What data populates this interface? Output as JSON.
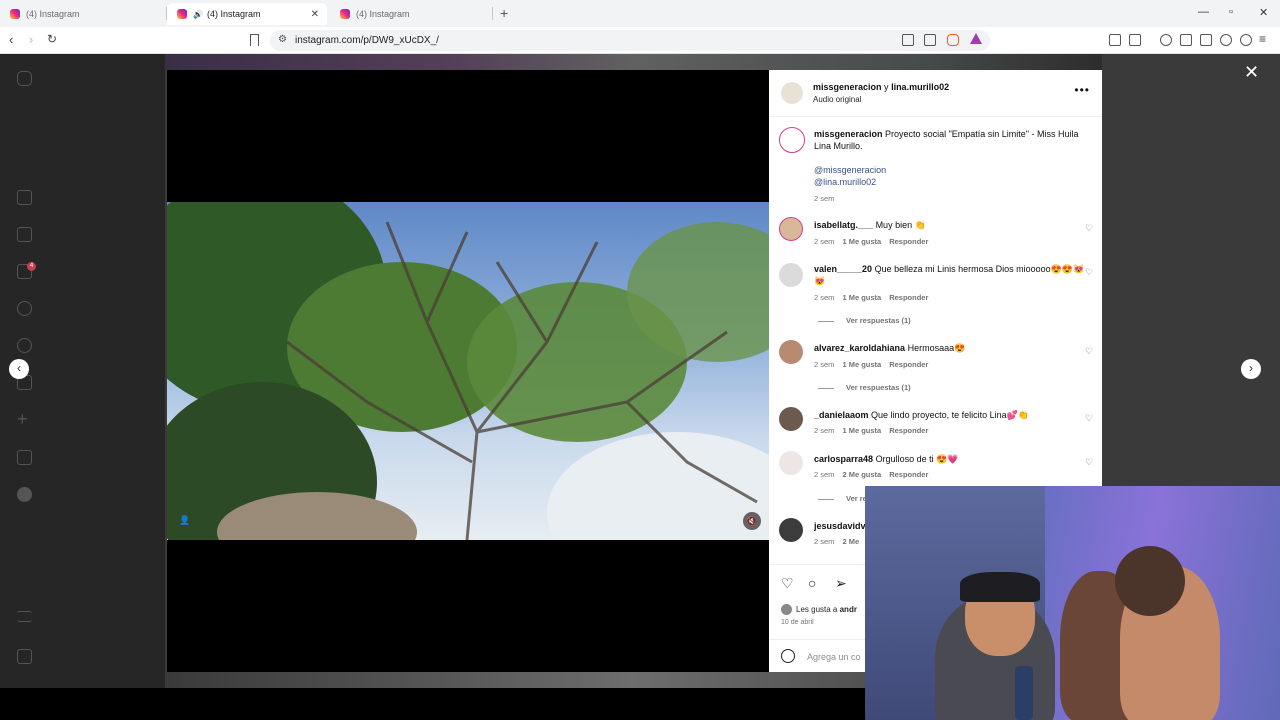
{
  "browser": {
    "tabs": [
      {
        "title": "(4) Instagram",
        "active": false
      },
      {
        "title": "(4) Instagram",
        "active": true
      },
      {
        "title": "(4) Instagram",
        "active": false
      }
    ],
    "url": "instagram.com/p/DW9_xUcDX_/",
    "window_controls": [
      "minimize",
      "restore",
      "close"
    ]
  },
  "sidebar": {
    "icons": [
      "instagram-logo-icon",
      "home-icon",
      "reels-icon",
      "messages-icon",
      "search-icon",
      "explore-icon",
      "notifications-icon",
      "create-icon",
      "dashboard-icon",
      "profile-icon",
      "more-icon",
      "also-from-meta-icon"
    ],
    "messages_badge": "4"
  },
  "post": {
    "header_user_1": "missgeneracion",
    "header_joiner": "y",
    "header_user_2": "lina.murillo02",
    "audio": "Audio original",
    "caption_user": "missgeneracion",
    "caption_text": "Proyecto social \"Empatía sin Limite\" - Miss Huila Lina Murillo.",
    "mention_1": "@missgeneracion",
    "mention_2": "@lina.murillo02",
    "caption_time": "2 sem",
    "likes_prefix": "Les gusta a",
    "likes_user": "andr",
    "date": "10 de abril",
    "add_comment_placeholder": "Agrega un co"
  },
  "comments": [
    {
      "user": "isabellatg.___",
      "text": "Muy bien 👏",
      "time": "2 sem",
      "likes": "1 Me gusta",
      "reply": "Responder",
      "replies": ""
    },
    {
      "user": "valen_____20",
      "text": "Que belleza mi Linis hermosa Dios miooooo😍😍😻😻",
      "time": "2 sem",
      "likes": "1 Me gusta",
      "reply": "Responder",
      "replies": "Ver respuestas (1)"
    },
    {
      "user": "alvarez_karoldahiana",
      "text": "Hermosaaa😍",
      "time": "2 sem",
      "likes": "1 Me gusta",
      "reply": "Responder",
      "replies": "Ver respuestas (1)"
    },
    {
      "user": "_danielaaom",
      "text": "Que lindo proyecto, te felicito Lina💕👏",
      "time": "2 sem",
      "likes": "1 Me gusta",
      "reply": "Responder",
      "replies": ""
    },
    {
      "user": "carlosparra48",
      "text": "Orgulloso de ti 😍💗",
      "time": "2 sem",
      "likes": "2 Me gusta",
      "reply": "Responder",
      "replies": "Ver re"
    },
    {
      "user": "jesusdavidve",
      "text": "",
      "time": "2 sem",
      "likes": "2 Me",
      "reply": "",
      "replies": ""
    }
  ],
  "colors": {
    "accent_link": "#385185",
    "page_bg": "#3a3a3a",
    "sidebar_bg": "#262626"
  }
}
